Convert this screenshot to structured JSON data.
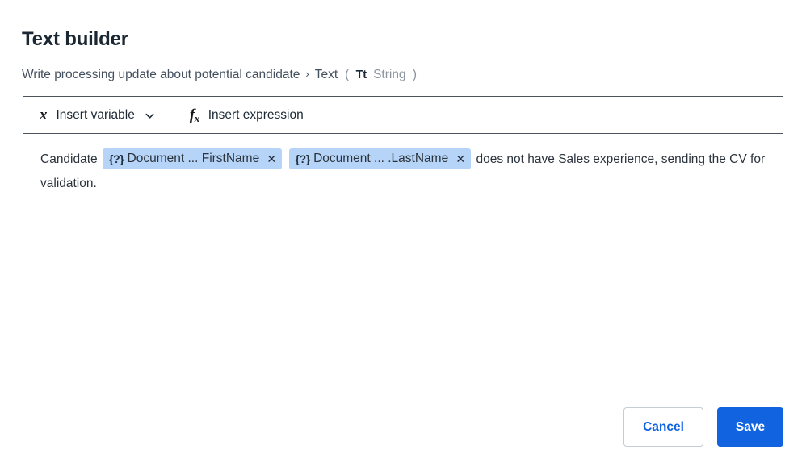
{
  "header": {
    "title": "Text builder",
    "breadcrumb": {
      "parent": "Write processing update about potential candidate",
      "separator": "›",
      "leaf": "Text",
      "paren_open": "(",
      "type_icon": "Tt",
      "type_name": "String",
      "paren_close": ")"
    }
  },
  "toolbar": {
    "insert_variable": {
      "icon": "x",
      "label": "Insert variable",
      "chevron_icon": "chevron-down-icon"
    },
    "insert_expression": {
      "icon_f": "f",
      "icon_x": "x",
      "label": "Insert expression"
    }
  },
  "editor": {
    "segments": [
      {
        "kind": "text",
        "value": "Candidate "
      },
      {
        "kind": "chip",
        "brace": "{?}",
        "label": "Document ... FirstName",
        "close": "✕"
      },
      {
        "kind": "text",
        "value": " "
      },
      {
        "kind": "chip",
        "brace": "{?}",
        "label": "Document ... .LastName",
        "close": "✕"
      },
      {
        "kind": "text",
        "value": " does not have Sales experience, sending the CV for validation."
      }
    ]
  },
  "footer": {
    "cancel_label": "Cancel",
    "save_label": "Save"
  },
  "colors": {
    "accent": "#1263e0",
    "chip_background": "#b6d4f7",
    "panel_border": "#4b535c",
    "muted_text": "#8b949e"
  }
}
